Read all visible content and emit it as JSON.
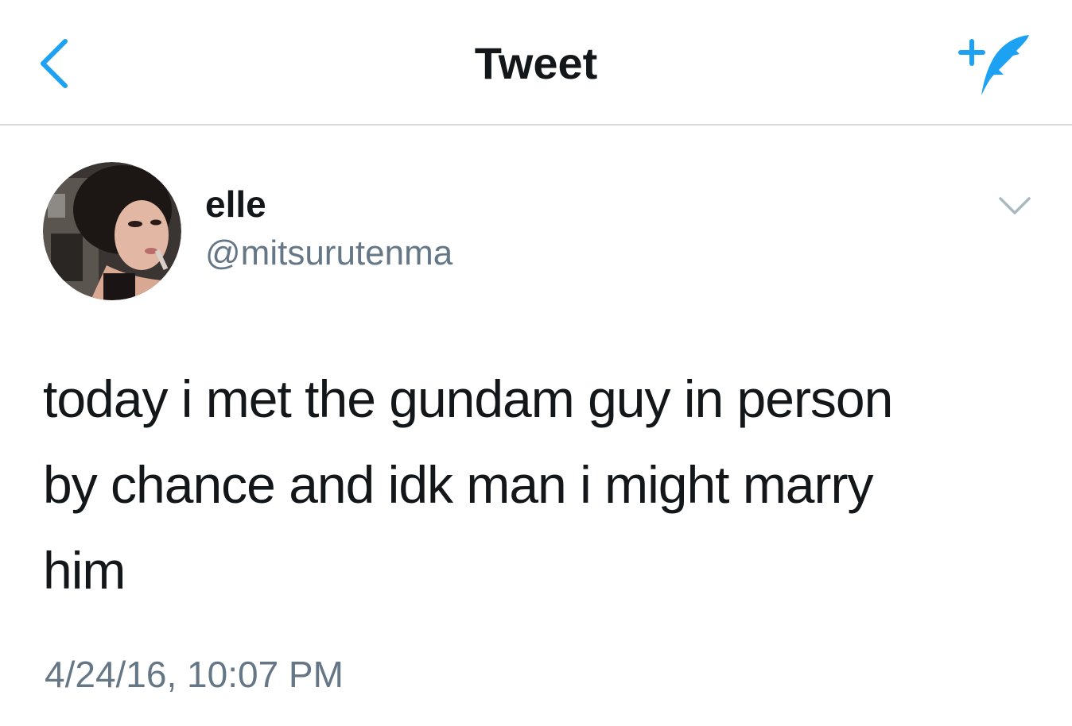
{
  "nav": {
    "back_icon": "chevron-left-icon",
    "title": "Tweet",
    "compose_icon": "compose-tweet-icon"
  },
  "tweet": {
    "avatar": "user-avatar-photo",
    "display_name": "elle",
    "handle": "@mitsurutenma",
    "more_icon": "chevron-down-icon",
    "text": "today i met the gundam guy in person\nby chance and idk man i might marry\nhim",
    "timestamp": "4/24/16, 10:07 PM"
  },
  "colors": {
    "accent": "#1da1f2",
    "text_primary": "#14171a",
    "text_secondary": "#657786",
    "divider": "#d7dadd",
    "icon_muted": "#aab8c2"
  }
}
